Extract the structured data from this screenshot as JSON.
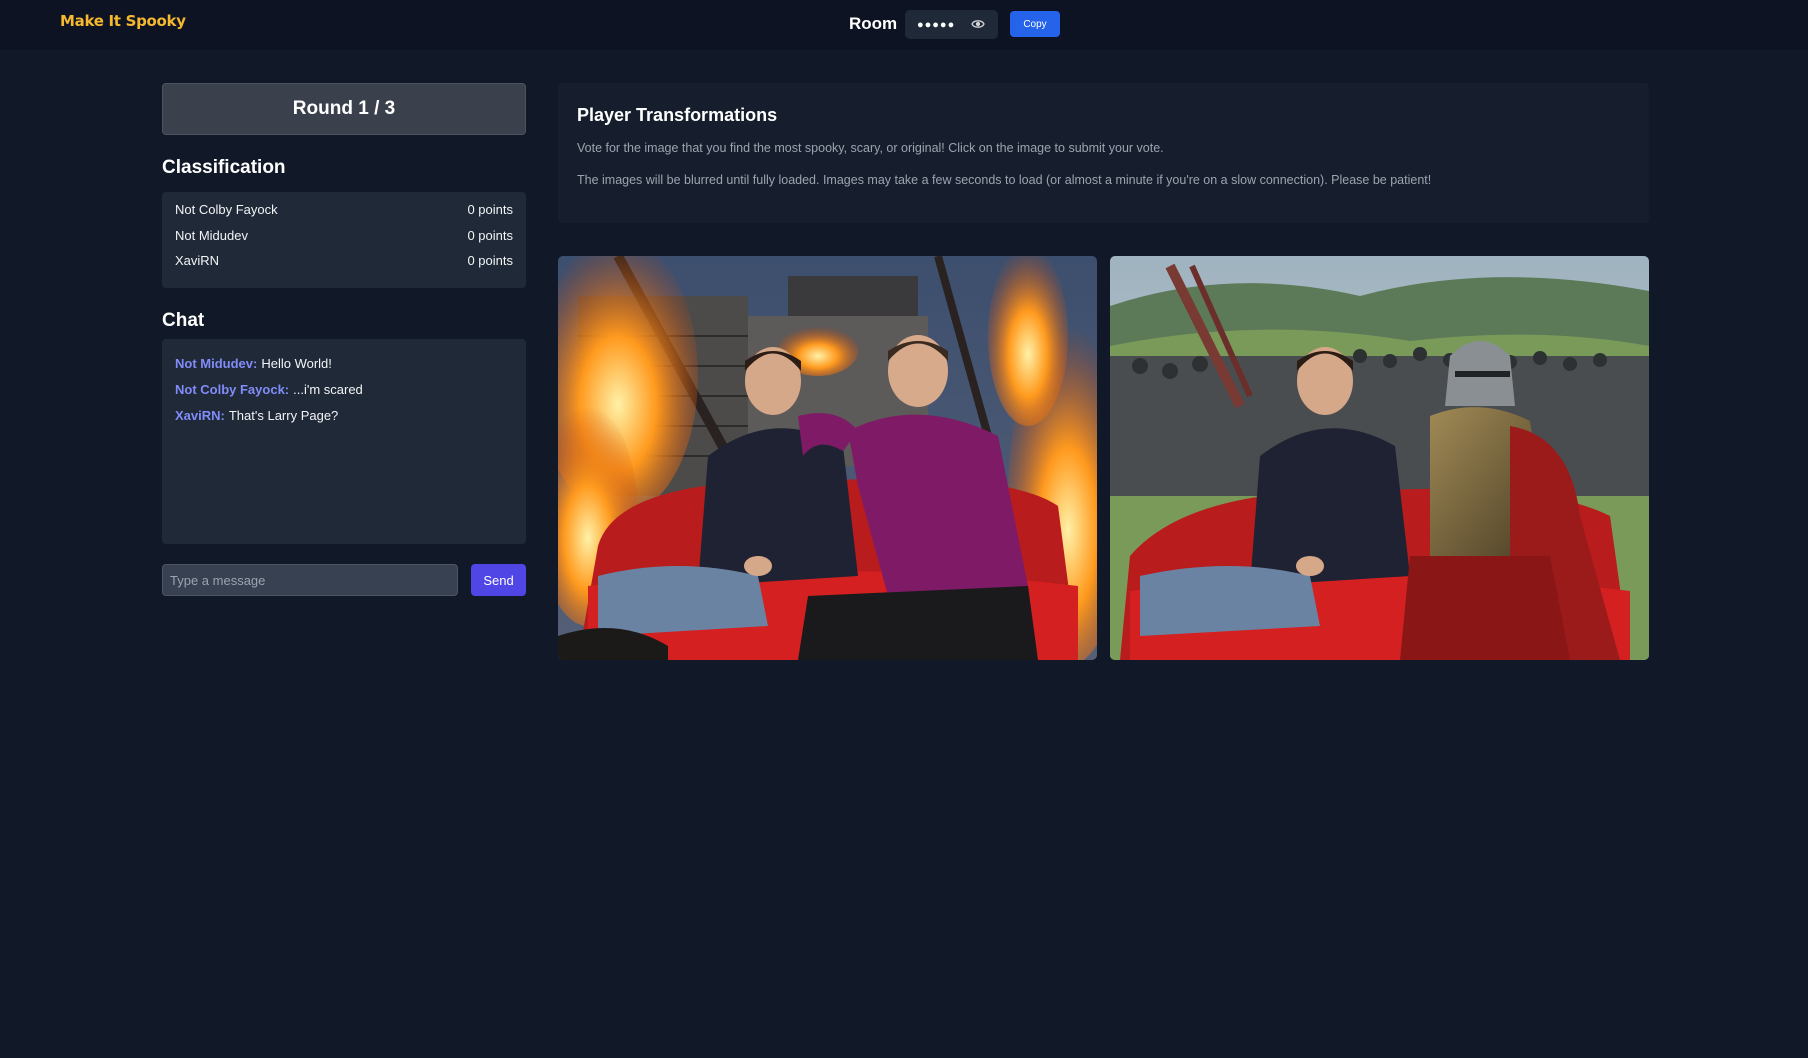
{
  "header": {
    "logo": "Make It Spooky",
    "room_label": "Room",
    "room_code_masked": "●●●●●",
    "copy_label": "Copy",
    "icons": {
      "reveal": "eye-icon"
    }
  },
  "round": {
    "label": "Round 1 / 3"
  },
  "classification": {
    "title": "Classification",
    "rows": [
      {
        "name": "Not Colby Fayock",
        "score": "0 points"
      },
      {
        "name": "Not Midudev",
        "score": "0 points"
      },
      {
        "name": "XaviRN",
        "score": "0 points"
      }
    ]
  },
  "chat": {
    "title": "Chat",
    "messages": [
      {
        "user": "Not Midudev:",
        "text": "Hello World!"
      },
      {
        "user": "Not Colby Fayock:",
        "text": "...i'm scared"
      },
      {
        "user": "XaviRN:",
        "text": "That's Larry Page?"
      }
    ],
    "input_placeholder": "Type a message",
    "input_value": "",
    "send_label": "Send"
  },
  "transformations": {
    "title": "Player Transformations",
    "instructions": "Vote for the image that you find the most spooky, scary, or original! Click on the image to submit your vote.",
    "notice": "The images will be blurred until fully loaded. Images may take a few seconds to load (or almost a minute if you're on a slow connection). Please be patient!",
    "images": [
      {
        "description_name": "burning-house-couch-image"
      },
      {
        "description_name": "knight-army-couch-image"
      }
    ]
  },
  "colors": {
    "background": "#111827",
    "header_bg": "#0d1322",
    "logo": "#f5b82e",
    "accent_blue": "#2563eb",
    "accent_indigo": "#4f46e5",
    "chat_user": "#818cf8"
  }
}
